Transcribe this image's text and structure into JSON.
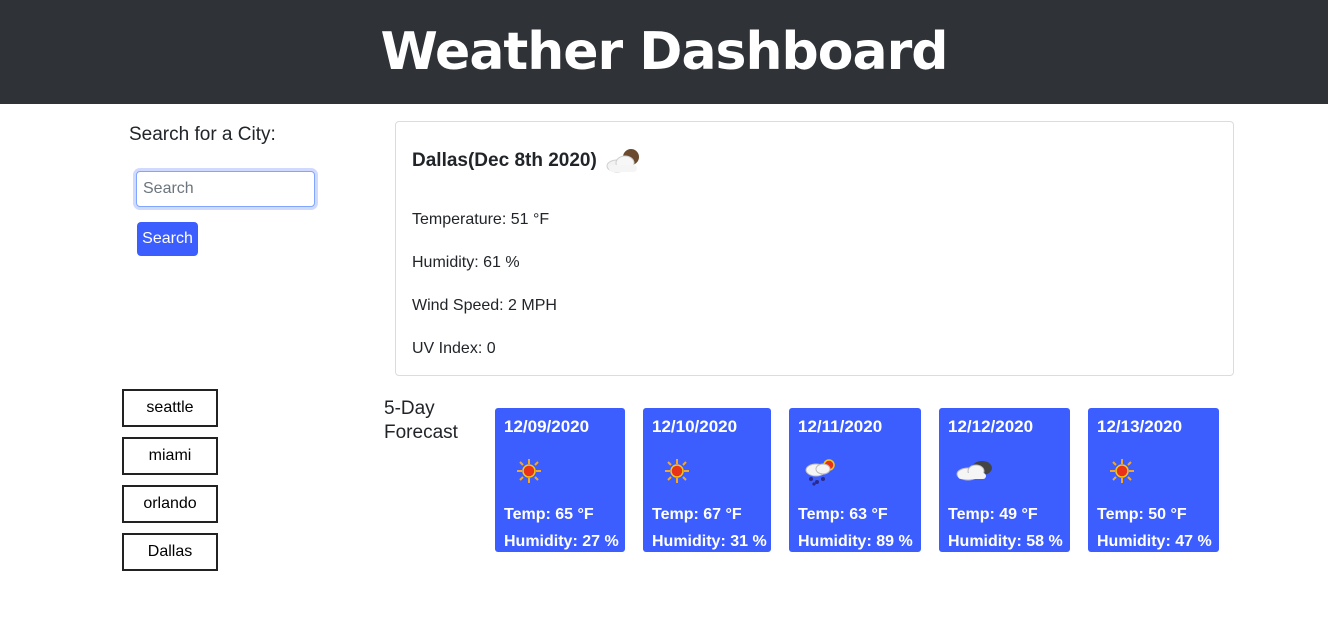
{
  "header": {
    "title": "Weather Dashboard"
  },
  "search": {
    "label": "Search for a City:",
    "placeholder": "Search",
    "value": "",
    "button_label": "Search"
  },
  "current": {
    "title": "Dallas(Dec 8th 2020)",
    "icon": "cloud-moon-icon",
    "temperature": "Temperature: 51 °F",
    "humidity": "Humidity: 61 %",
    "wind": "Wind Speed: 2 MPH",
    "uv": "UV Index: 0"
  },
  "history": [
    {
      "label": "seattle"
    },
    {
      "label": "miami"
    },
    {
      "label": "orlando"
    },
    {
      "label": "Dallas"
    }
  ],
  "forecast": {
    "label": "5-Day Forecast",
    "days": [
      {
        "date": "12/09/2020",
        "icon": "sun-icon",
        "temp": "Temp: 65 °F",
        "humidity": "Humidity: 27 %"
      },
      {
        "date": "12/10/2020",
        "icon": "sun-icon",
        "temp": "Temp: 67 °F",
        "humidity": "Humidity: 31 %"
      },
      {
        "date": "12/11/2020",
        "icon": "rain-sun-icon",
        "temp": "Temp: 63 °F",
        "humidity": "Humidity: 89 %"
      },
      {
        "date": "12/12/2020",
        "icon": "cloud-icon",
        "temp": "Temp: 49 °F",
        "humidity": "Humidity: 58 %"
      },
      {
        "date": "12/13/2020",
        "icon": "sun-icon",
        "temp": "Temp: 50 °F",
        "humidity": "Humidity: 47 %"
      }
    ]
  },
  "colors": {
    "header_bg": "#2f3337",
    "accent": "#3d5eff"
  }
}
